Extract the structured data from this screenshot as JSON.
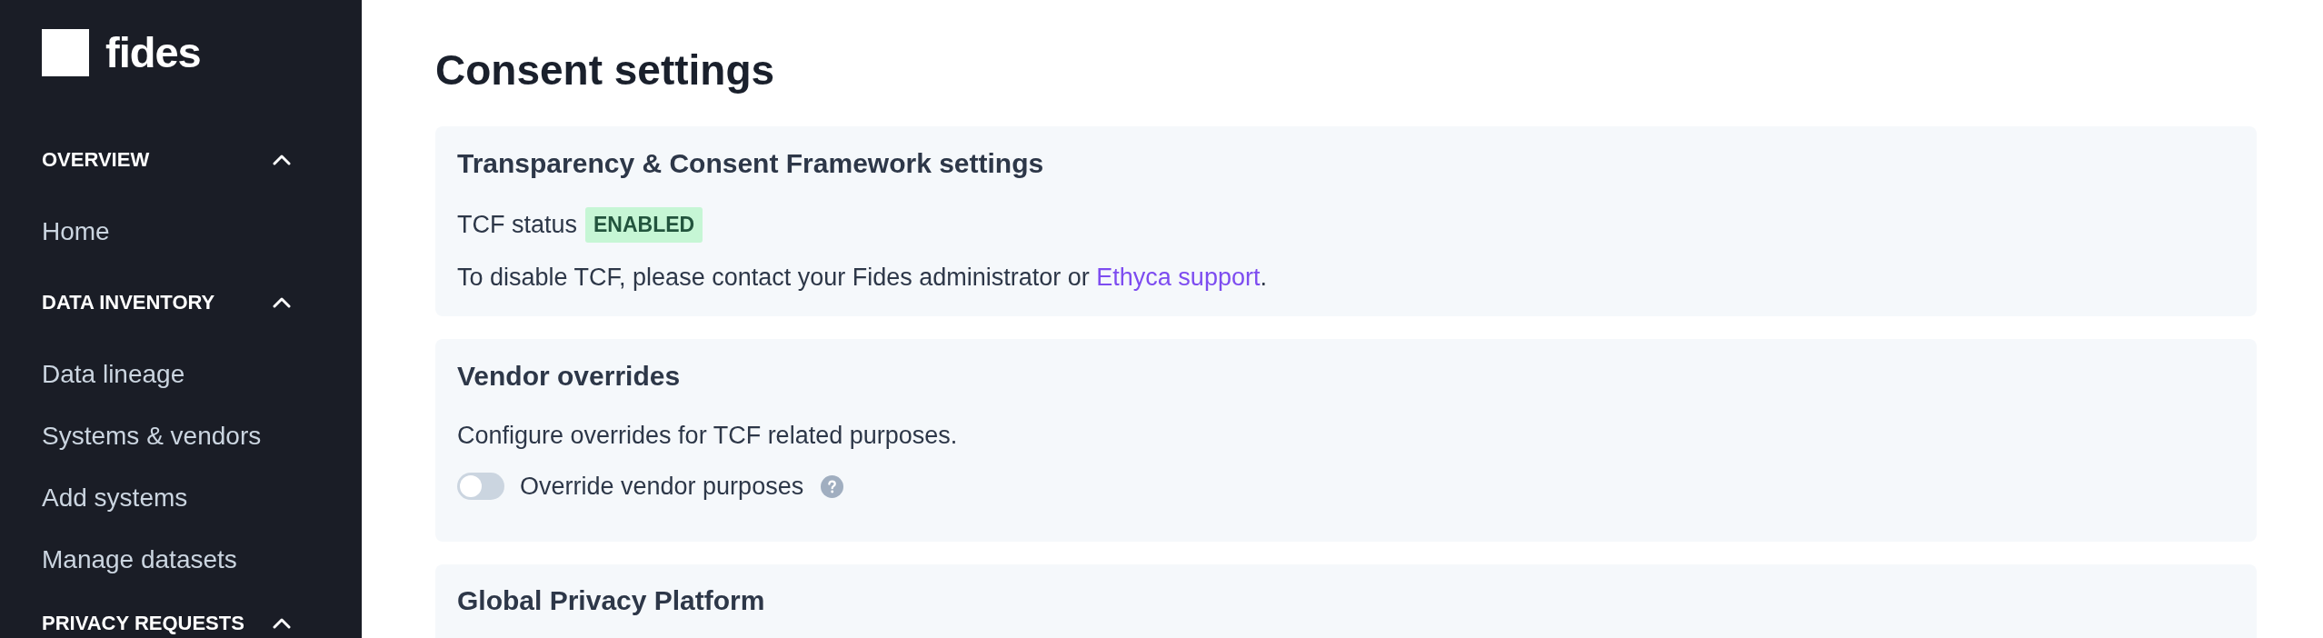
{
  "sidebar": {
    "logo": "fides",
    "sections": [
      {
        "title": "OVERVIEW",
        "expanded": true,
        "items": [
          {
            "label": "Home",
            "selected": false
          }
        ]
      },
      {
        "title": "DATA INVENTORY",
        "expanded": true,
        "items": [
          {
            "label": "Data lineage",
            "selected": false
          },
          {
            "label": "Systems & vendors",
            "selected": false
          },
          {
            "label": "Add systems",
            "selected": false
          },
          {
            "label": "Manage datasets",
            "selected": false
          }
        ]
      },
      {
        "title": "PRIVACY REQUESTS",
        "expanded": true
      }
    ]
  },
  "page_title": "Consent settings",
  "cards": [
    {
      "title": "Transparency & Consent Framework settings",
      "blocks": [
        {
          "kind": "status",
          "label": "TCF status",
          "badge": "ENABLED"
        },
        {
          "kind": "text",
          "text": "To disable TCF, please contact your Fides administrator or ",
          "link": "Ethyca support",
          "text_after": "."
        }
      ]
    },
    {
      "title": "Vendor overrides",
      "blocks": [
        {
          "kind": "text",
          "text": "Configure overrides for TCF related purposes."
        },
        {
          "kind": "toggle",
          "label": "Override vendor purposes",
          "on": false
        }
      ]
    },
    {
      "title": "Global Privacy Platform"
    }
  ]
}
